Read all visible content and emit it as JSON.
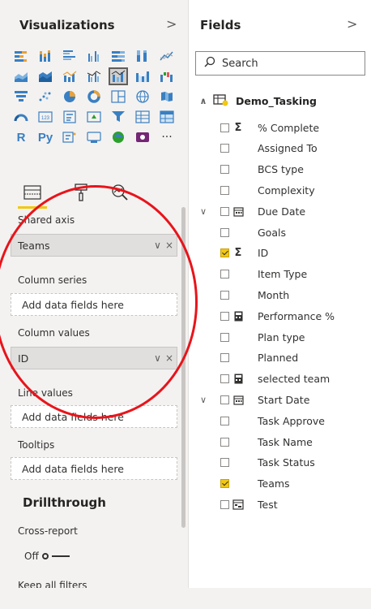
{
  "visualizations": {
    "title": "Visualizations",
    "collapse_chevron": ">",
    "icons": [
      "stacked-bar-chart-icon",
      "stacked-column-chart-icon",
      "clustered-bar-chart-icon",
      "clustered-column-chart-icon",
      "100pct-stacked-bar-chart-icon",
      "100pct-stacked-column-chart-icon",
      "line-chart-icon",
      "area-chart-icon",
      "stacked-area-chart-icon",
      "line-and-stacked-column-chart-icon",
      "line-and-clustered-column-chart-icon",
      "ribbon-chart-icon",
      "waterfall-chart-icon",
      "funnel-chart-icon",
      "scatter-chart-icon",
      "pie-chart-icon",
      "donut-chart-icon",
      "treemap-icon",
      "map-icon",
      "filled-map-icon",
      "gauge-icon",
      "card-icon",
      "multi-row-card-icon",
      "kpi-icon",
      "slicer-icon",
      "table-icon",
      "matrix-icon",
      "r-visual-icon",
      "python-visual-icon",
      "key-influencers-icon",
      "decomposition-tree-icon",
      "arcgis-map-icon",
      "power-apps-icon",
      "more-visuals-icon"
    ],
    "r_label": "R",
    "py_label": "Py",
    "more_label": "···",
    "tabs": [
      "fields-tab-icon",
      "format-tab-icon",
      "analytics-tab-icon"
    ],
    "shared_axis": {
      "label": "Shared axis",
      "value": "Teams"
    },
    "column_series": {
      "label": "Column series",
      "placeholder": "Add data fields here"
    },
    "column_values": {
      "label": "Column values",
      "value": "ID"
    },
    "line_values": {
      "label": "Line values",
      "placeholder": "Add data fields here"
    },
    "tooltips": {
      "label": "Tooltips",
      "placeholder": "Add data fields here"
    },
    "drillthrough": {
      "title": "Drillthrough",
      "cross_report_label": "Cross-report",
      "cross_report_state": "Off",
      "keep_filters_label": "Keep all filters"
    },
    "well_controls": {
      "chevron": "∨",
      "remove": "×"
    }
  },
  "fields": {
    "title": "Fields",
    "collapse_chevron": ">",
    "search_placeholder": "Search",
    "table_name": "Demo_Tasking",
    "items": [
      {
        "name": "% Complete",
        "type": "sigma",
        "checked": false,
        "expander": false
      },
      {
        "name": "Assigned To",
        "type": "none",
        "checked": false,
        "expander": false
      },
      {
        "name": "BCS type",
        "type": "none",
        "checked": false,
        "expander": false
      },
      {
        "name": "Complexity",
        "type": "none",
        "checked": false,
        "expander": false
      },
      {
        "name": "Due Date",
        "type": "calendar",
        "checked": false,
        "expander": true
      },
      {
        "name": "Goals",
        "type": "none",
        "checked": false,
        "expander": false
      },
      {
        "name": "ID",
        "type": "sigma",
        "checked": true,
        "expander": false
      },
      {
        "name": "Item Type",
        "type": "none",
        "checked": false,
        "expander": false
      },
      {
        "name": "Month",
        "type": "none",
        "checked": false,
        "expander": false
      },
      {
        "name": "Performance %",
        "type": "calculator",
        "checked": false,
        "expander": false
      },
      {
        "name": "Plan type",
        "type": "none",
        "checked": false,
        "expander": false
      },
      {
        "name": "Planned",
        "type": "none",
        "checked": false,
        "expander": false
      },
      {
        "name": "selected team",
        "type": "calculator",
        "checked": false,
        "expander": false
      },
      {
        "name": "Start Date",
        "type": "calendar",
        "checked": false,
        "expander": true
      },
      {
        "name": "Task Approve",
        "type": "none",
        "checked": false,
        "expander": false
      },
      {
        "name": "Task Name",
        "type": "none",
        "checked": false,
        "expander": false
      },
      {
        "name": "Task Status",
        "type": "none",
        "checked": false,
        "expander": false
      },
      {
        "name": "Teams",
        "type": "none",
        "checked": true,
        "expander": false
      },
      {
        "name": "Test",
        "type": "hierarchy",
        "checked": false,
        "expander": false
      }
    ]
  },
  "colors": {
    "accent": "#f2c811",
    "annotation": "#e8141b",
    "pane_bg": "#f3f2f1"
  }
}
